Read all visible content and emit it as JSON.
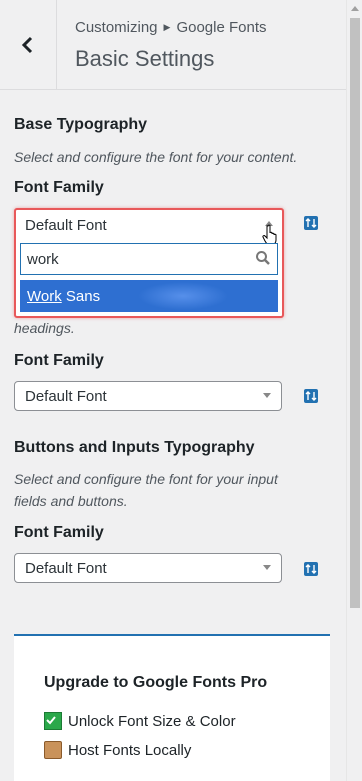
{
  "header": {
    "breadcrumb_parent": "Customizing",
    "breadcrumb_current": "Google Fonts",
    "title": "Basic Settings"
  },
  "base": {
    "title": "Base Typography",
    "description": "Select and configure the font for your content.",
    "font_label": "Font Family",
    "open_select": {
      "value": "Default Font",
      "search_value": "work",
      "result_match": "Work",
      "result_rest": " Sans"
    }
  },
  "headings": {
    "description_tail": "headings.",
    "font_label": "Font Family",
    "select_value": "Default Font"
  },
  "buttons": {
    "title": "Buttons and Inputs Typography",
    "description_line1": "Select and configure the font for your input",
    "description_line2": "fields and buttons.",
    "font_label": "Font Family",
    "select_value": "Default Font"
  },
  "upgrade": {
    "title": "Upgrade to Google Fonts Pro",
    "features": [
      "Unlock Font Size & Color",
      "Host Fonts Locally"
    ]
  },
  "icons": {
    "back": "chevron-left-icon",
    "revert": "arrow-up-down-icon",
    "search": "search-icon",
    "feature_1": "check-icon",
    "feature_2": "box-icon"
  },
  "colors": {
    "accent": "#2271b1",
    "highlight": "#e8585a",
    "selected": "#2e6fd1"
  }
}
